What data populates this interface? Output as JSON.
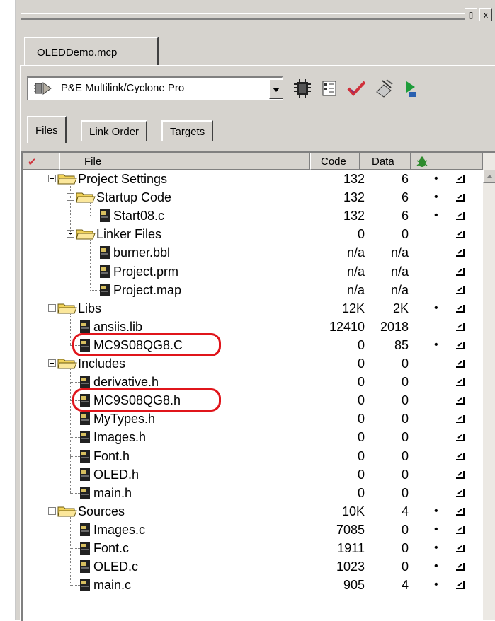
{
  "window": {
    "close_glyph": "x",
    "restore_glyph": "▯"
  },
  "document_tab": {
    "label": "OLEDDemo.mcp"
  },
  "target": {
    "selected": "P&E Multilink/Cyclone Pro",
    "icon": "debugger-connection-icon"
  },
  "toolbar": {
    "icons": [
      "chip-settings-icon",
      "project-sheet-icon",
      "check-sync-icon",
      "make-icon",
      "debug-run-icon"
    ]
  },
  "tabs": [
    {
      "label": "Files",
      "active": true
    },
    {
      "label": "Link Order",
      "active": false
    },
    {
      "label": "Targets",
      "active": false
    }
  ],
  "columns": {
    "check": "✔",
    "file": "File",
    "code": "Code",
    "data": "Data",
    "debug": "debug-bug-icon"
  },
  "rows": [
    {
      "name": "Project Settings",
      "code": "132",
      "data": "6",
      "dot": "•",
      "depth": 0,
      "type": "folder"
    },
    {
      "name": "Startup Code",
      "code": "132",
      "data": "6",
      "dot": "•",
      "depth": 1,
      "type": "folder"
    },
    {
      "name": "Start08.c",
      "code": "132",
      "data": "6",
      "dot": "•",
      "depth": 2,
      "type": "file"
    },
    {
      "name": "Linker Files",
      "code": "0",
      "data": "0",
      "dot": "",
      "depth": 1,
      "type": "folder"
    },
    {
      "name": "burner.bbl",
      "code": "n/a",
      "data": "n/a",
      "dot": "",
      "depth": 2,
      "type": "file"
    },
    {
      "name": "Project.prm",
      "code": "n/a",
      "data": "n/a",
      "dot": "",
      "depth": 2,
      "type": "file"
    },
    {
      "name": "Project.map",
      "code": "n/a",
      "data": "n/a",
      "dot": "",
      "depth": 2,
      "type": "file"
    },
    {
      "name": "Libs",
      "code": "12K",
      "data": "2K",
      "dot": "•",
      "depth": 0,
      "type": "folder"
    },
    {
      "name": "ansiis.lib",
      "code": "12410",
      "data": "2018",
      "dot": "",
      "depth": 1,
      "type": "file"
    },
    {
      "name": "MC9S08QG8.C",
      "code": "0",
      "data": "85",
      "dot": "•",
      "depth": 1,
      "type": "file",
      "highlight": true
    },
    {
      "name": "Includes",
      "code": "0",
      "data": "0",
      "dot": "",
      "depth": 0,
      "type": "folder"
    },
    {
      "name": "derivative.h",
      "code": "0",
      "data": "0",
      "dot": "",
      "depth": 1,
      "type": "file"
    },
    {
      "name": "MC9S08QG8.h",
      "code": "0",
      "data": "0",
      "dot": "",
      "depth": 1,
      "type": "file",
      "highlight": true
    },
    {
      "name": "MyTypes.h",
      "code": "0",
      "data": "0",
      "dot": "",
      "depth": 1,
      "type": "file"
    },
    {
      "name": "Images.h",
      "code": "0",
      "data": "0",
      "dot": "",
      "depth": 1,
      "type": "file"
    },
    {
      "name": "Font.h",
      "code": "0",
      "data": "0",
      "dot": "",
      "depth": 1,
      "type": "file"
    },
    {
      "name": "OLED.h",
      "code": "0",
      "data": "0",
      "dot": "",
      "depth": 1,
      "type": "file"
    },
    {
      "name": "main.h",
      "code": "0",
      "data": "0",
      "dot": "",
      "depth": 1,
      "type": "file"
    },
    {
      "name": "Sources",
      "code": "10K",
      "data": "4",
      "dot": "•",
      "depth": 0,
      "type": "folder"
    },
    {
      "name": "Images.c",
      "code": "7085",
      "data": "0",
      "dot": "•",
      "depth": 1,
      "type": "file"
    },
    {
      "name": "Font.c",
      "code": "1911",
      "data": "0",
      "dot": "•",
      "depth": 1,
      "type": "file"
    },
    {
      "name": "OLED.c",
      "code": "1023",
      "data": "0",
      "dot": "•",
      "depth": 1,
      "type": "file"
    },
    {
      "name": "main.c",
      "code": "905",
      "data": "4",
      "dot": "•",
      "depth": 1,
      "type": "file"
    }
  ],
  "colors": {
    "panel": "#d6d3ce",
    "highlight": "#e0151b",
    "folder": "#f2d35a",
    "check": "#d0303a"
  }
}
